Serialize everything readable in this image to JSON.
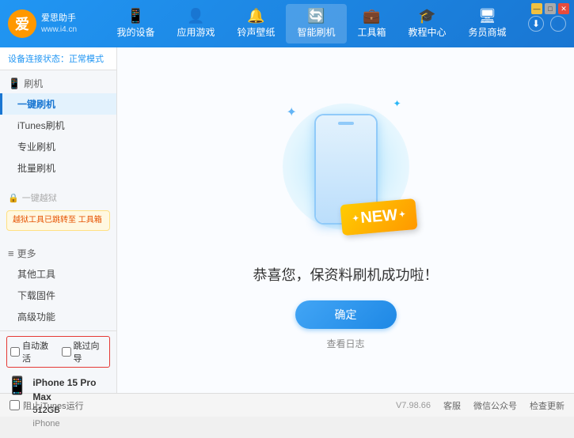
{
  "app": {
    "logo_char": "爱",
    "logo_line1": "爱思助手",
    "logo_line2": "www.i4.cn"
  },
  "nav": {
    "items": [
      {
        "id": "my-device",
        "icon": "📱",
        "label": "我的设备"
      },
      {
        "id": "apps-games",
        "icon": "👤",
        "label": "应用游戏"
      },
      {
        "id": "ringtones",
        "icon": "🔔",
        "label": "铃声壁纸"
      },
      {
        "id": "smart-flash",
        "icon": "🔄",
        "label": "智能刷机",
        "active": true
      },
      {
        "id": "toolbox",
        "icon": "💼",
        "label": "工具箱"
      },
      {
        "id": "tutorials",
        "icon": "🎓",
        "label": "教程中心"
      },
      {
        "id": "service",
        "icon": "🖥",
        "label": "务员商城"
      }
    ]
  },
  "header_right": {
    "download_icon": "⬇",
    "user_icon": "👤"
  },
  "window_controls": {
    "min": "—",
    "max": "□",
    "close": "✕"
  },
  "sidebar": {
    "status_label": "设备连接状态：",
    "status_value": "正常模式",
    "sections": [
      {
        "id": "flash",
        "icon": "📱",
        "label": "刷机",
        "items": [
          {
            "id": "one-click-flash",
            "label": "一键刷机",
            "active": true
          },
          {
            "id": "itunes-flash",
            "label": "iTunes刷机"
          },
          {
            "id": "pro-flash",
            "label": "专业刷机"
          },
          {
            "id": "batch-flash",
            "label": "批量刷机"
          }
        ]
      }
    ],
    "disabled_section": {
      "icon": "🔒",
      "label": "一键越狱"
    },
    "notice": "越狱工具已跳转至\n工具箱",
    "more_section": {
      "label": "更多",
      "items": [
        {
          "id": "other-tools",
          "label": "其他工具"
        },
        {
          "id": "download-firmware",
          "label": "下载固件"
        },
        {
          "id": "advanced",
          "label": "高级功能"
        }
      ]
    },
    "auto_detect_label": "自动激活",
    "guided_activate_label": "跳过向导",
    "device": {
      "name": "iPhone 15 Pro Max",
      "storage": "512GB",
      "type": "iPhone"
    }
  },
  "content": {
    "new_badge": "NEW",
    "success_title": "恭喜您，保资料刷机成功啦！",
    "confirm_button": "确定",
    "log_link": "查看日志"
  },
  "footer": {
    "stop_itunes_label": "阻止iTunes运行",
    "version": "V7.98.66",
    "official_link": "客服",
    "wechat_link": "微信公众号",
    "check_update_link": "检查更新"
  }
}
